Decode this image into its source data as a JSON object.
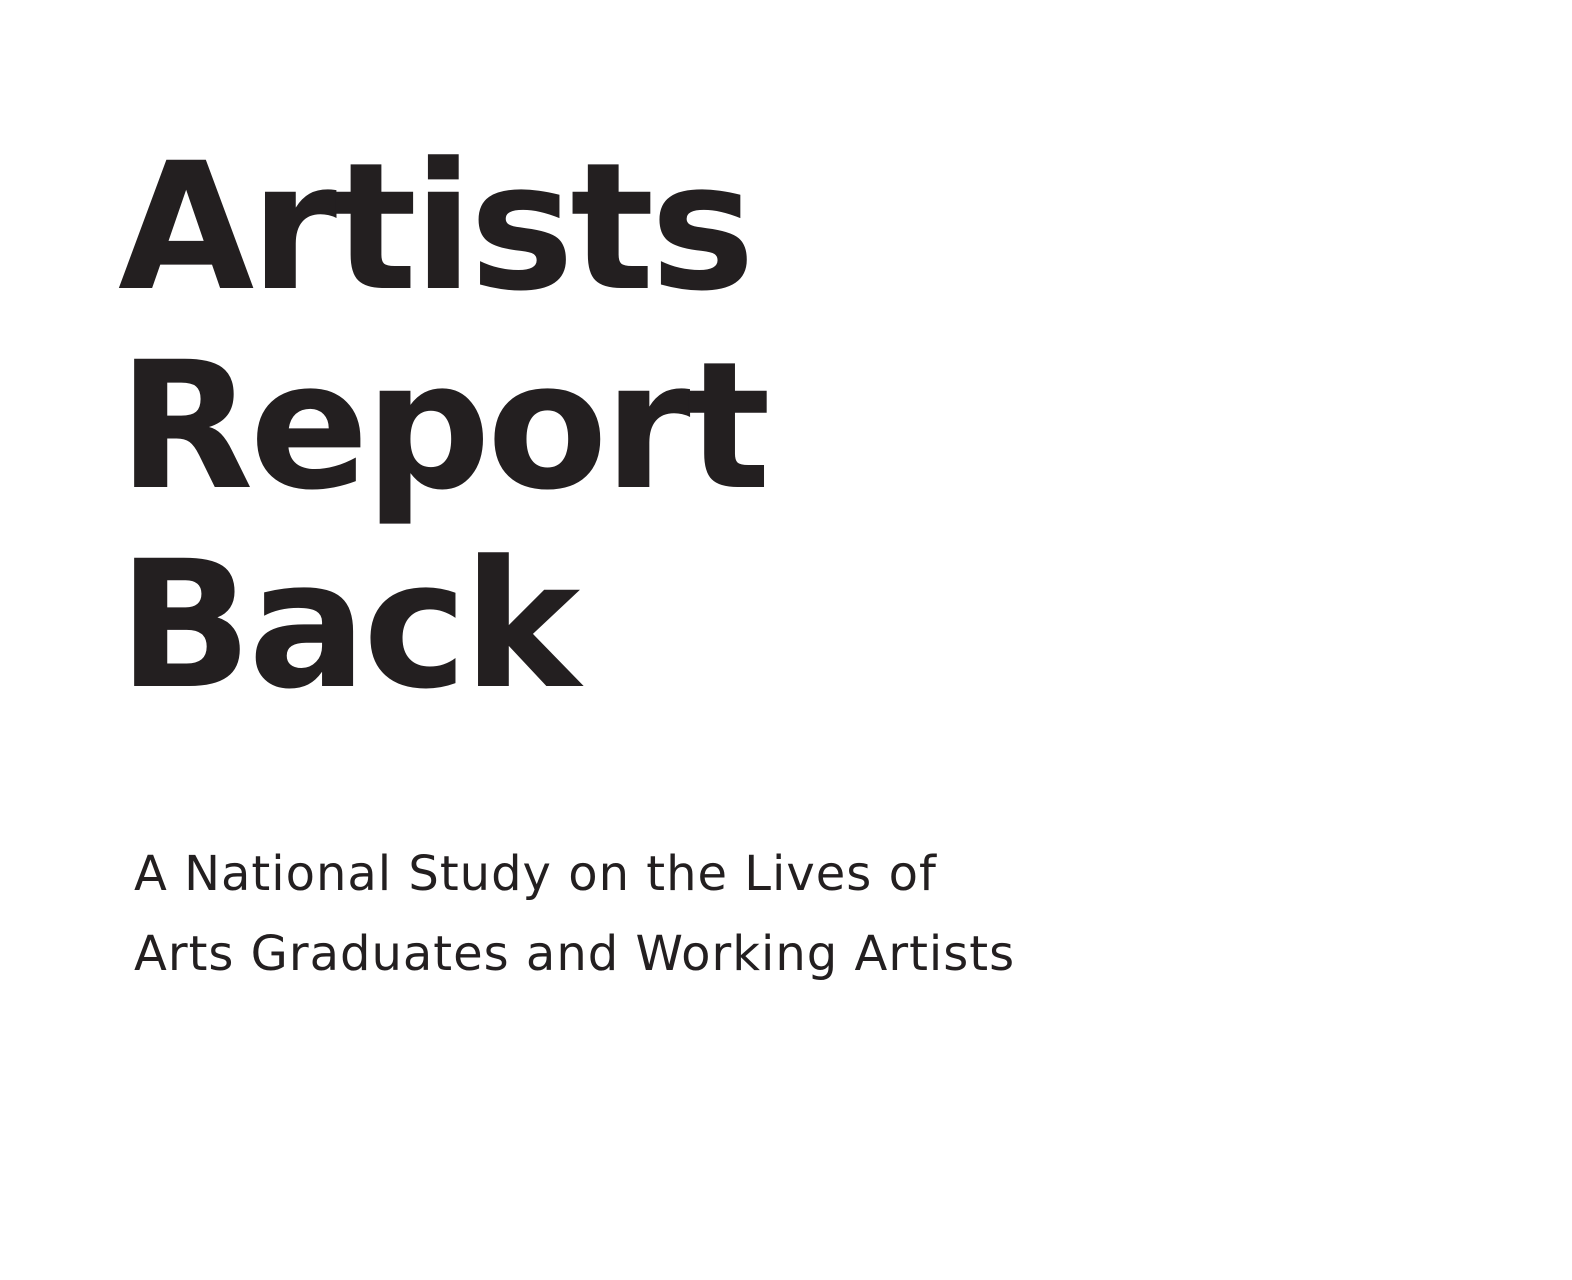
{
  "document": {
    "title_lines": [
      "Artists",
      "Report",
      "Back"
    ],
    "subtitle_lines": [
      "A National Study on the Lives of",
      "Arts Graduates and Working Artists"
    ]
  },
  "colors": {
    "text": "#231f20",
    "background": "#ffffff"
  }
}
